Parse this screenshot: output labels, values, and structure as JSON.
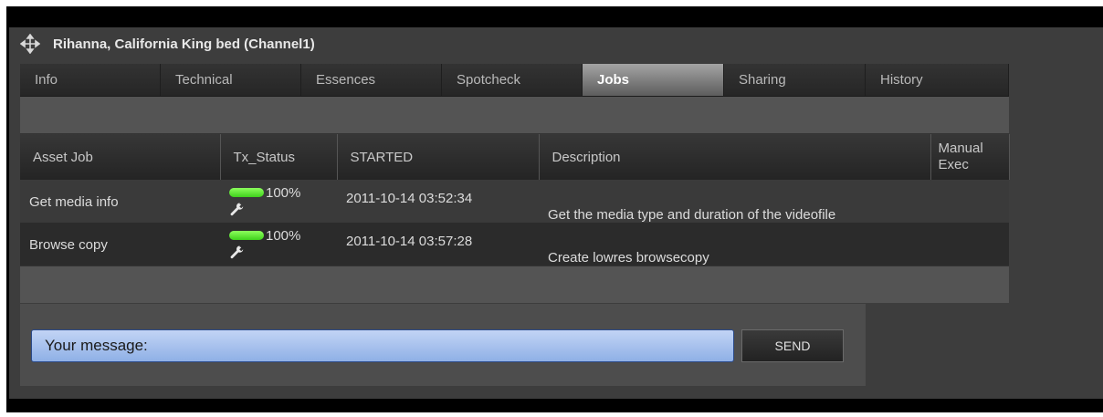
{
  "window": {
    "title": "Rihanna, California King bed (Channel1)"
  },
  "tabs": [
    {
      "label": "Info",
      "active": false
    },
    {
      "label": "Technical",
      "active": false
    },
    {
      "label": "Essences",
      "active": false
    },
    {
      "label": "Spotcheck",
      "active": false
    },
    {
      "label": "Jobs",
      "active": true
    },
    {
      "label": "Sharing",
      "active": false
    },
    {
      "label": "History",
      "active": false
    }
  ],
  "table": {
    "headers": {
      "asset_job": "Asset Job",
      "tx_status": "Tx_Status",
      "started": "STARTED",
      "description": "Description",
      "manual_exec": "Manual Exec"
    },
    "rows": [
      {
        "job": "Get media info",
        "progress": 1.0,
        "progress_label": "100%",
        "started": "2011-10-14 03:52:34",
        "description": "Get the media type and duration of the videofile"
      },
      {
        "job": "Browse copy",
        "progress": 1.0,
        "progress_label": "100%",
        "started": "2011-10-14 03:57:28",
        "description": "Create lowres browsecopy"
      }
    ]
  },
  "message": {
    "placeholder": "Your message:",
    "send_label": "SEND"
  },
  "colors": {
    "progress": "#3fd11c",
    "input_bg": "#8fb0e6",
    "active_tab": "#a4a4a4"
  },
  "icons": {
    "move": "move-arrows-icon",
    "status": "wrench-icon"
  }
}
